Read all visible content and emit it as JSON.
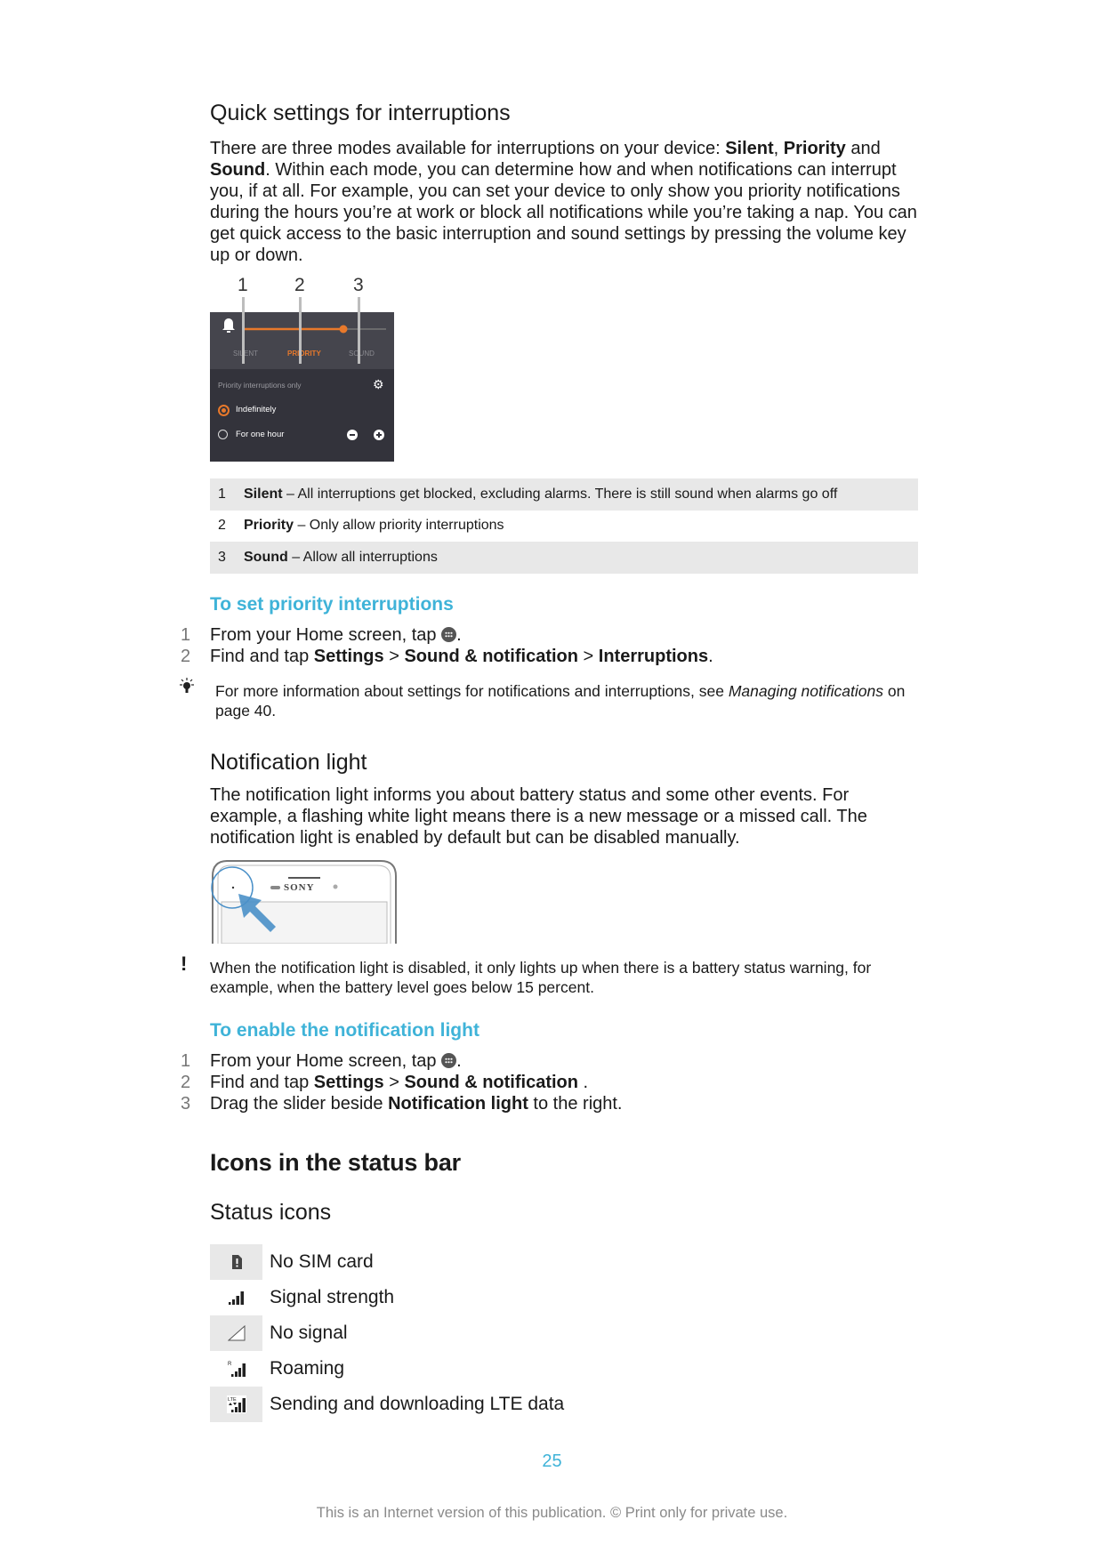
{
  "section1": {
    "heading": "Quick settings for interruptions",
    "intro": [
      {
        "t": "There are three modes available for interruptions on your device: "
      },
      {
        "t": "Silent",
        "b": true
      },
      {
        "t": ", "
      },
      {
        "t": "Priority",
        "b": true
      },
      {
        "t": " and "
      },
      {
        "t": "Sound",
        "b": true
      },
      {
        "t": ". Within each mode, you can determine how and when notifications can interrupt you, if at all. For example, you can set your device to only show you priority notifications during the hours you’re at work or block all notifications while you’re taking a nap. You can get quick access to the basic interruption and sound settings by pressing the volume key up or down."
      }
    ],
    "screenshot": {
      "callouts": [
        "1",
        "2",
        "3"
      ],
      "modes": [
        "SILENT",
        "PRIORITY",
        "SOUND"
      ],
      "selected_mode": "PRIORITY",
      "panel_title": "Priority interruptions only",
      "options": [
        {
          "label": "Indefinitely",
          "selected": true
        },
        {
          "label": "For one hour",
          "selected": false
        }
      ],
      "accent_color": "#e8792b"
    },
    "legend": [
      {
        "num": "1",
        "term": "Silent",
        "desc": " – All interruptions get blocked, excluding alarms. There is still sound when alarms go off"
      },
      {
        "num": "2",
        "term": "Priority",
        "desc": " – Only allow priority interruptions"
      },
      {
        "num": "3",
        "term": "Sound",
        "desc": " – Allow all interruptions"
      }
    ],
    "procedure_title": "To set priority interruptions",
    "steps": [
      {
        "num": "1",
        "parts": [
          {
            "t": "From your Home screen, tap "
          },
          {
            "icon": "apps"
          },
          {
            "t": "."
          }
        ]
      },
      {
        "num": "2",
        "parts": [
          {
            "t": "Find and tap "
          },
          {
            "t": "Settings",
            "b": true
          },
          {
            "t": " > "
          },
          {
            "t": "Sound & notification",
            "b": true
          },
          {
            "t": " > "
          },
          {
            "t": "Interruptions",
            "b": true
          },
          {
            "t": "."
          }
        ]
      }
    ],
    "tip": [
      {
        "t": "For more information about settings for notifications and interruptions, see "
      },
      {
        "t": "Managing notifications",
        "i": true
      },
      {
        "t": " on page 40."
      }
    ]
  },
  "section2": {
    "heading": "Notification light",
    "intro": "The notification light informs you about battery status and some other events. For example, a flashing white light means there is a new message or a missed call. The notification light is enabled by default but can be disabled manually.",
    "phone_brand": "SONY",
    "warning": "When the notification light is disabled, it only lights up when there is a battery status warning, for example, when the battery level goes below 15 percent.",
    "procedure_title": "To enable the notification light",
    "steps": [
      {
        "num": "1",
        "parts": [
          {
            "t": "From your Home screen, tap "
          },
          {
            "icon": "apps"
          },
          {
            "t": "."
          }
        ]
      },
      {
        "num": "2",
        "parts": [
          {
            "t": "Find and tap "
          },
          {
            "t": "Settings",
            "b": true
          },
          {
            "t": " > "
          },
          {
            "t": "Sound & notification",
            "b": true
          },
          {
            "t": " ."
          }
        ]
      },
      {
        "num": "3",
        "parts": [
          {
            "t": "Drag the slider beside "
          },
          {
            "t": "Notification light",
            "b": true
          },
          {
            "t": " to the right."
          }
        ]
      }
    ]
  },
  "section3": {
    "heading": "Icons in the status bar",
    "subheading": "Status icons",
    "icons": [
      {
        "icon": "no-sim-icon",
        "label": "No SIM card"
      },
      {
        "icon": "signal-strength-icon",
        "label": "Signal strength"
      },
      {
        "icon": "no-signal-icon",
        "label": "No signal"
      },
      {
        "icon": "roaming-icon",
        "label": "Roaming"
      },
      {
        "icon": "lte-data-icon",
        "label": "Sending and downloading LTE data"
      }
    ]
  },
  "footer": {
    "page_number": "25",
    "notice": "This is an Internet version of this publication. © Print only for private use."
  },
  "colors": {
    "link_blue": "#3fb3d8",
    "shade_grey": "#e8e8e8"
  }
}
